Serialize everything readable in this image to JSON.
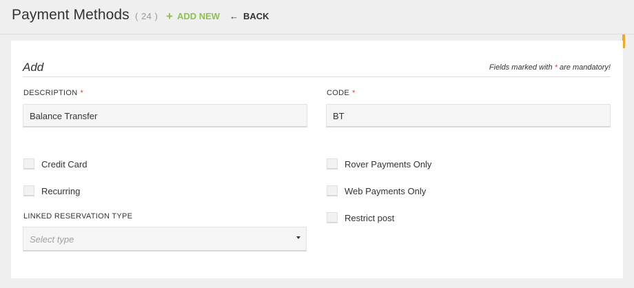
{
  "header": {
    "title": "Payment Methods",
    "count": "( 24 )",
    "add_new_label": "ADD NEW",
    "back_label": "BACK"
  },
  "form": {
    "title": "Add",
    "mandatory_note_prefix": "Fields marked with ",
    "mandatory_star": "*",
    "mandatory_note_suffix": " are mandatory!",
    "description": {
      "label": "DESCRIPTION",
      "required": "*",
      "value": "Balance Transfer"
    },
    "code": {
      "label": "CODE",
      "required": "*",
      "value": "BT"
    },
    "checkboxes_left": [
      {
        "label": "Credit Card",
        "checked": false
      },
      {
        "label": "Recurring",
        "checked": false
      }
    ],
    "checkboxes_right": [
      {
        "label": "Rover Payments Only",
        "checked": false
      },
      {
        "label": "Web Payments Only",
        "checked": false
      },
      {
        "label": "Restrict post",
        "checked": false
      }
    ],
    "linked_reservation": {
      "label": "LINKED RESERVATION TYPE",
      "placeholder": "Select type"
    }
  },
  "colors": {
    "accent_green": "#8bc34a",
    "required_red": "#e53935",
    "scroll_orange": "#f5a623"
  },
  "icons": {
    "add": "plus-icon",
    "back": "arrow-left-icon",
    "select": "caret-down-icon"
  }
}
